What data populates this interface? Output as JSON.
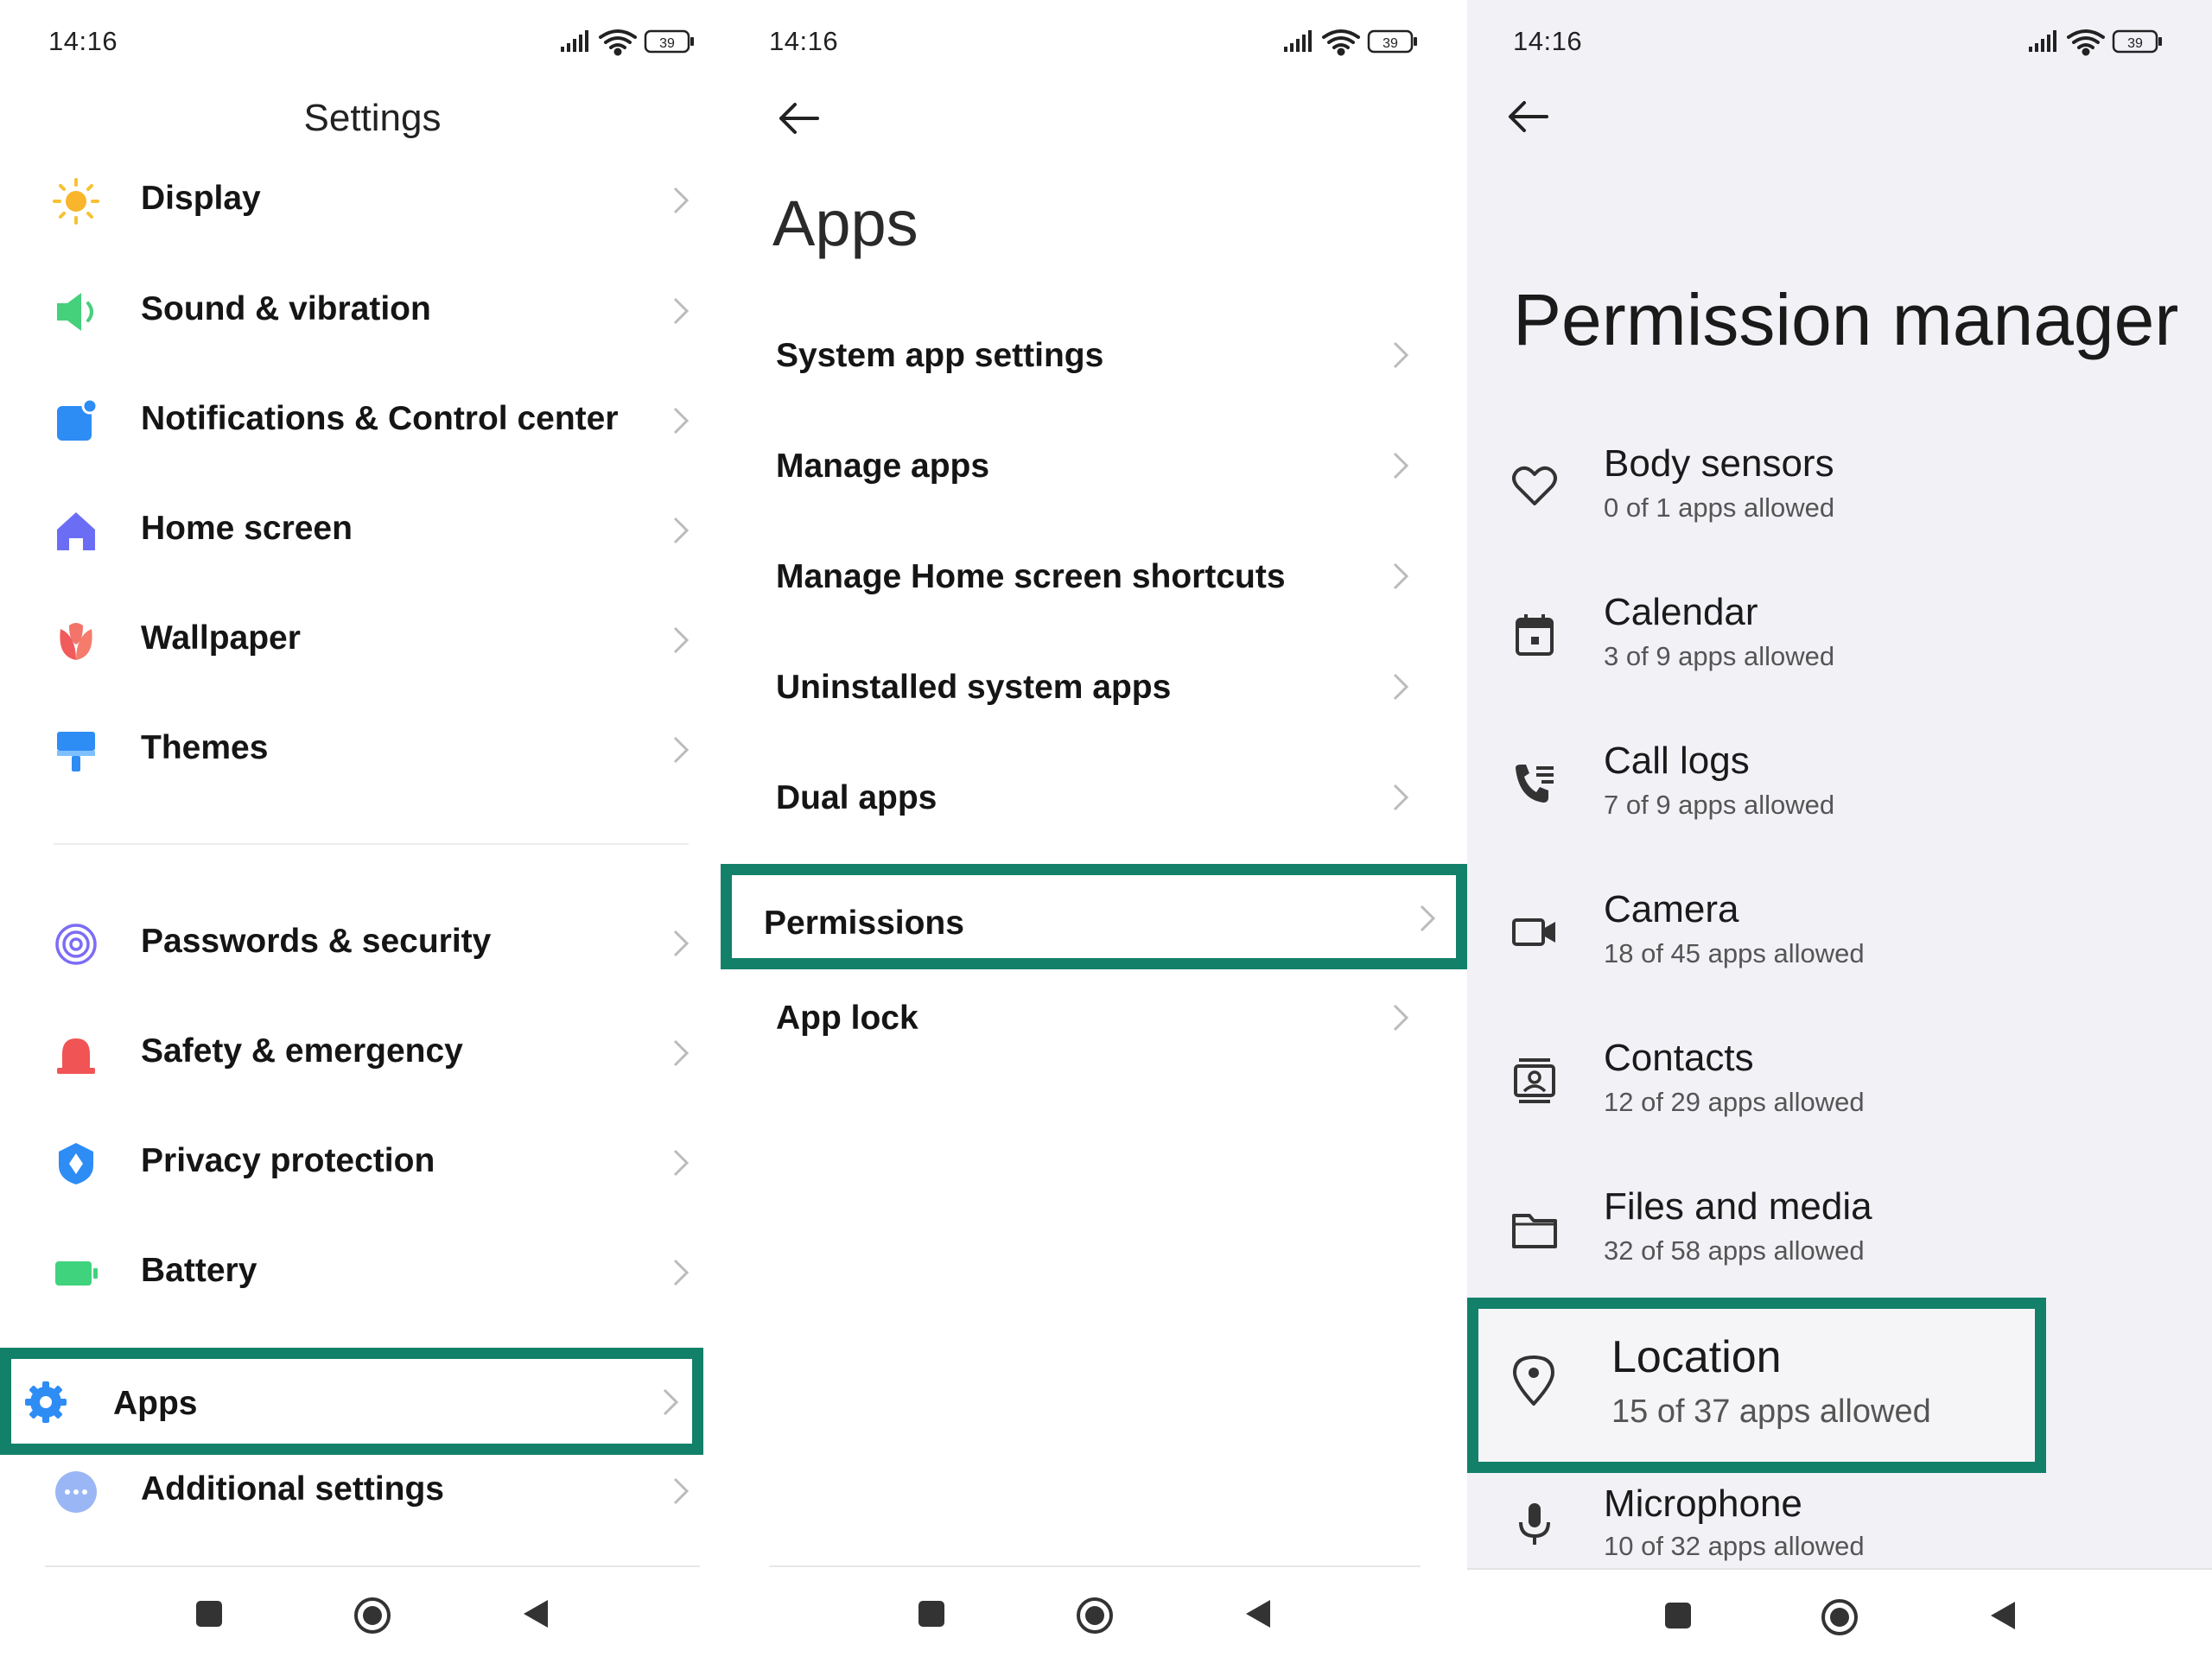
{
  "colors": {
    "highlight": "#13806a",
    "panel3_bg": "#f2f1f6"
  },
  "panel1": {
    "status": {
      "time": "14:16",
      "battery": "39"
    },
    "title": "Settings",
    "items": [
      {
        "label": "Display",
        "icon": "sun-icon"
      },
      {
        "label": "Sound & vibration",
        "icon": "speaker-icon"
      },
      {
        "label": "Notifications & Control center",
        "icon": "notification-icon"
      },
      {
        "label": "Home screen",
        "icon": "home-icon"
      },
      {
        "label": "Wallpaper",
        "icon": "flower-icon"
      },
      {
        "label": "Themes",
        "icon": "paintbrush-icon"
      },
      {
        "label": "Passwords & security",
        "icon": "fingerprint-icon"
      },
      {
        "label": "Safety & emergency",
        "icon": "siren-icon"
      },
      {
        "label": "Privacy protection",
        "icon": "shield-icon"
      },
      {
        "label": "Battery",
        "icon": "battery-icon"
      },
      {
        "label": "Apps",
        "icon": "gear-icon"
      },
      {
        "label": "Additional settings",
        "icon": "more-dots-icon"
      }
    ]
  },
  "panel2": {
    "status": {
      "time": "14:16",
      "battery": "39"
    },
    "title": "Apps",
    "items": [
      {
        "label": "System app settings"
      },
      {
        "label": "Manage apps"
      },
      {
        "label": "Manage Home screen shortcuts"
      },
      {
        "label": "Uninstalled system apps"
      },
      {
        "label": "Dual apps"
      },
      {
        "label": "Permissions"
      },
      {
        "label": "App lock"
      }
    ]
  },
  "panel3": {
    "status": {
      "time": "14:16",
      "battery": "39"
    },
    "title": "Permission manager",
    "items": [
      {
        "label": "Body sensors",
        "sub": "0 of 1 apps allowed",
        "icon": "heart-icon"
      },
      {
        "label": "Calendar",
        "sub": "3 of 9 apps allowed",
        "icon": "calendar-icon"
      },
      {
        "label": "Call logs",
        "sub": "7 of 9 apps allowed",
        "icon": "call-log-icon"
      },
      {
        "label": "Camera",
        "sub": "18 of 45 apps allowed",
        "icon": "camera-icon"
      },
      {
        "label": "Contacts",
        "sub": "12 of 29 apps allowed",
        "icon": "contacts-icon"
      },
      {
        "label": "Files and media",
        "sub": "32 of 58 apps allowed",
        "icon": "folder-icon"
      },
      {
        "label": "Location",
        "sub": "15 of 37 apps allowed",
        "icon": "location-pin-icon"
      },
      {
        "label": "Microphone",
        "sub": "10 of 32 apps allowed",
        "icon": "microphone-icon"
      }
    ]
  }
}
